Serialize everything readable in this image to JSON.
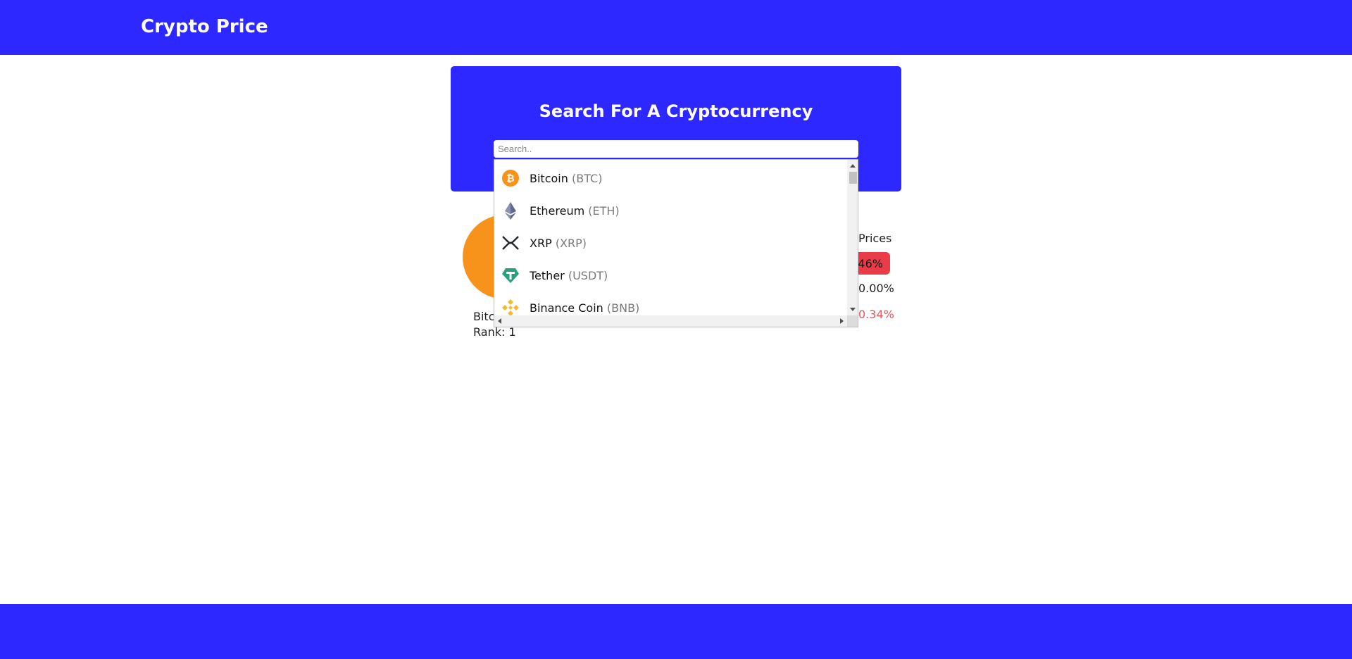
{
  "header": {
    "brand": "Crypto Price"
  },
  "search": {
    "title": "Search For A Cryptocurrency",
    "placeholder": "Search.."
  },
  "details": {
    "name_partial": "Bitc",
    "rank_text": "Rank: 1",
    "prices_label": "Prices",
    "badge_text": ".46%",
    "neutral_pct": "0.00%",
    "red_pct": "0.34%"
  },
  "dropdown": {
    "items": [
      {
        "name": "Bitcoin",
        "symbol": "(BTC)",
        "icon": "bitcoin-icon"
      },
      {
        "name": "Ethereum",
        "symbol": "(ETH)",
        "icon": "ethereum-icon"
      },
      {
        "name": "XRP",
        "symbol": "(XRP)",
        "icon": "xrp-icon"
      },
      {
        "name": "Tether",
        "symbol": "(USDT)",
        "icon": "tether-icon"
      },
      {
        "name": "Binance Coin",
        "symbol": "(BNB)",
        "icon": "binance-icon"
      }
    ]
  },
  "colors": {
    "brand_blue": "#2d28ff",
    "bitcoin_orange": "#f7931a",
    "badge_red": "#ea3c48",
    "negative_text": "#e0555c",
    "tether_teal": "#26a17b",
    "binance_yellow": "#f3ba2f"
  }
}
